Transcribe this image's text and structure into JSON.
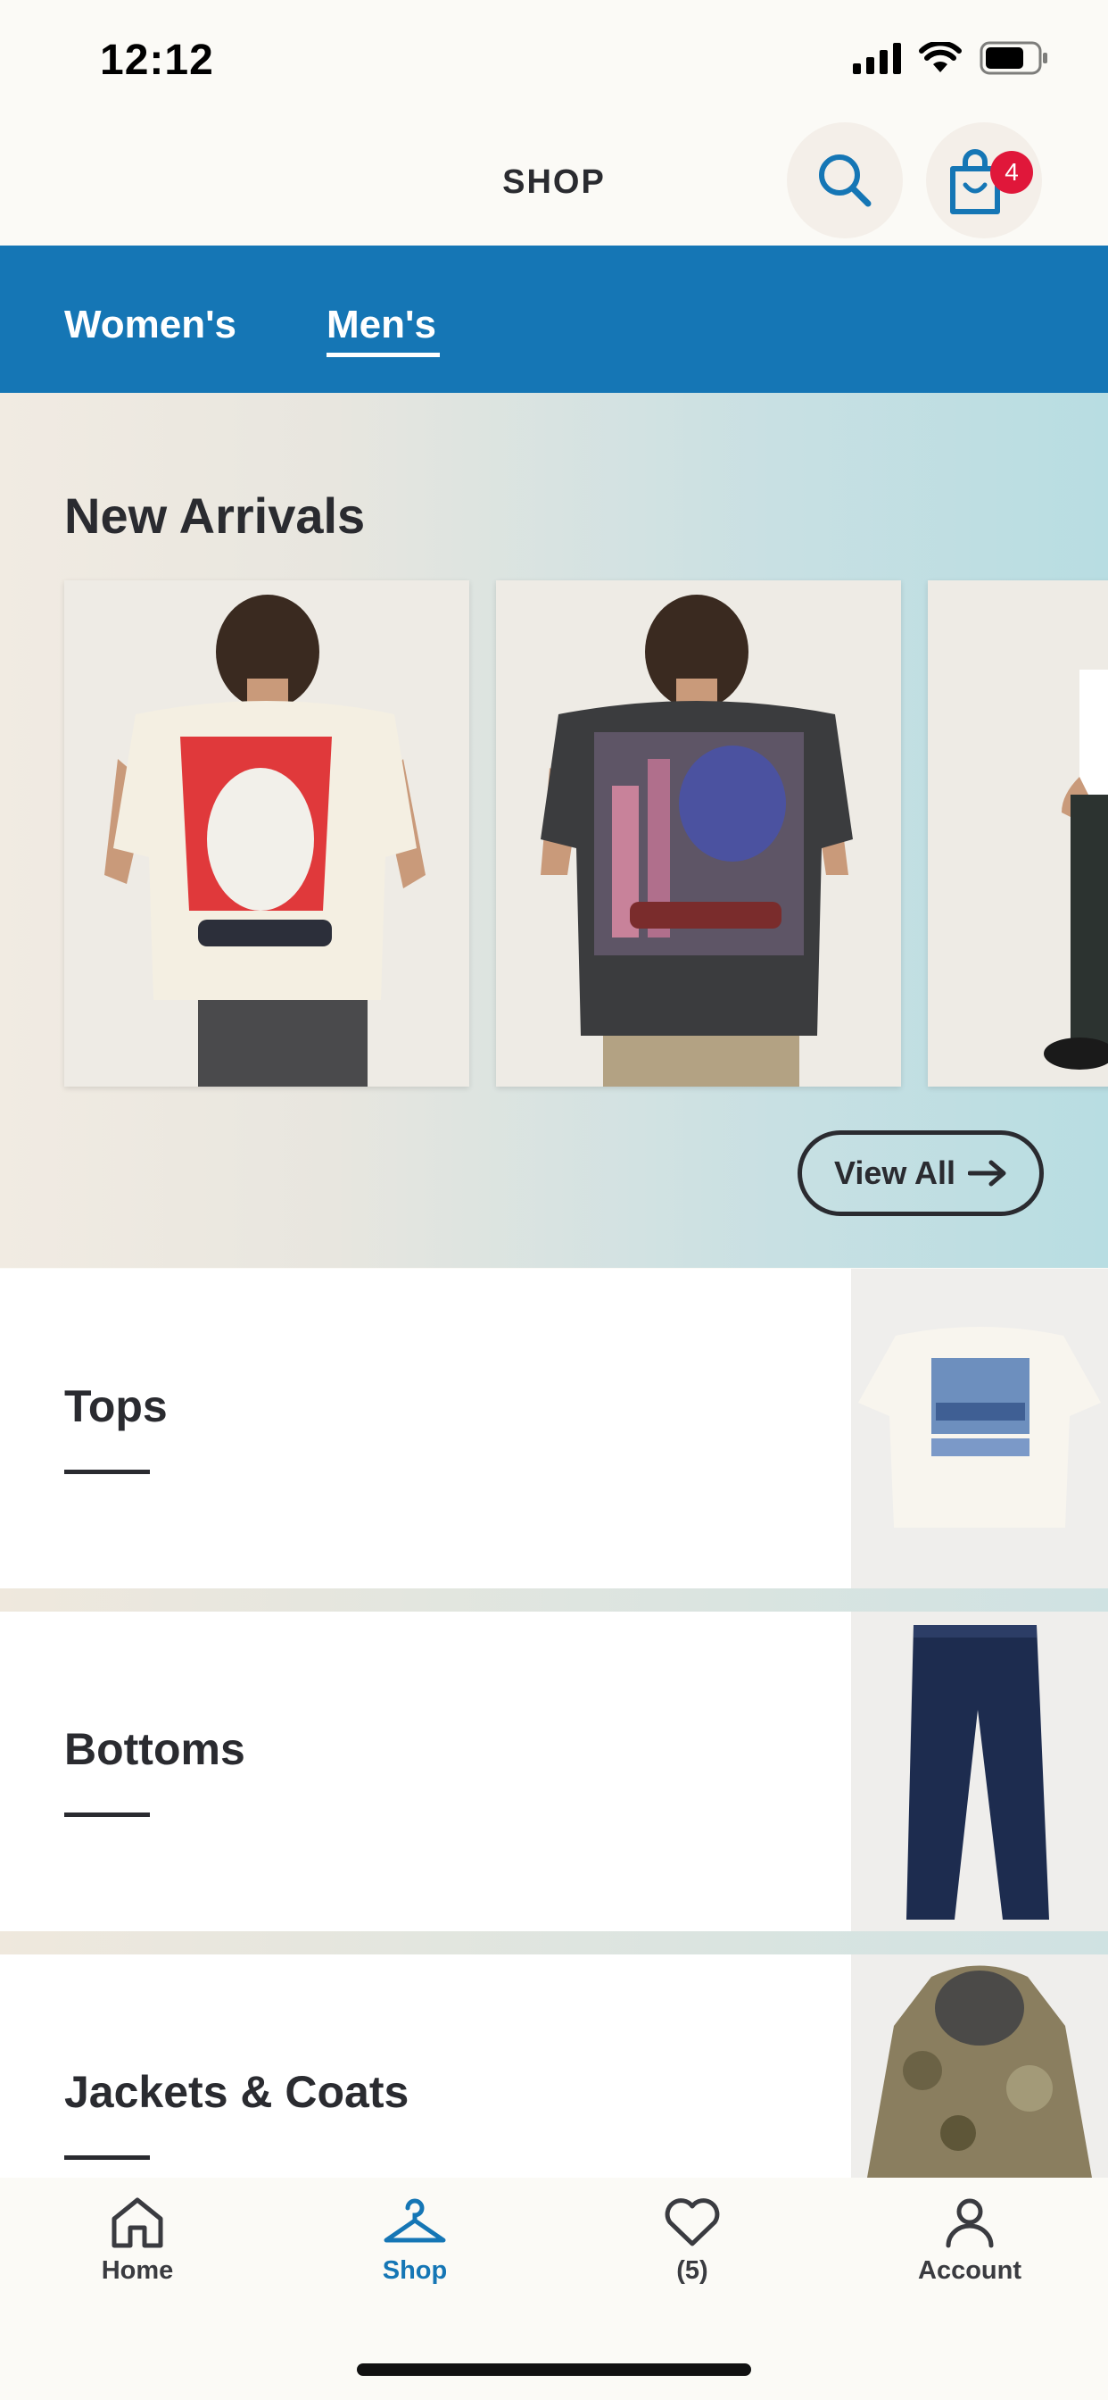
{
  "status_bar": {
    "time": "12:12"
  },
  "header": {
    "title": "SHOP",
    "cart_count": "4"
  },
  "tabs": [
    {
      "label": "Women's",
      "selected": false
    },
    {
      "label": "Men's",
      "selected": true
    }
  ],
  "new_arrivals": {
    "title": "New Arrivals",
    "view_all_label": "View All"
  },
  "categories": [
    {
      "label": "Tops"
    },
    {
      "label": "Bottoms"
    },
    {
      "label": "Jackets & Coats"
    }
  ],
  "bottom_nav": {
    "home_label": "Home",
    "shop_label": "Shop",
    "wishlist_label": "(5)",
    "account_label": "Account"
  },
  "colors": {
    "brand_blue": "#1576b5",
    "badge_red": "#e0173a",
    "text_dark": "#2a2b30"
  }
}
